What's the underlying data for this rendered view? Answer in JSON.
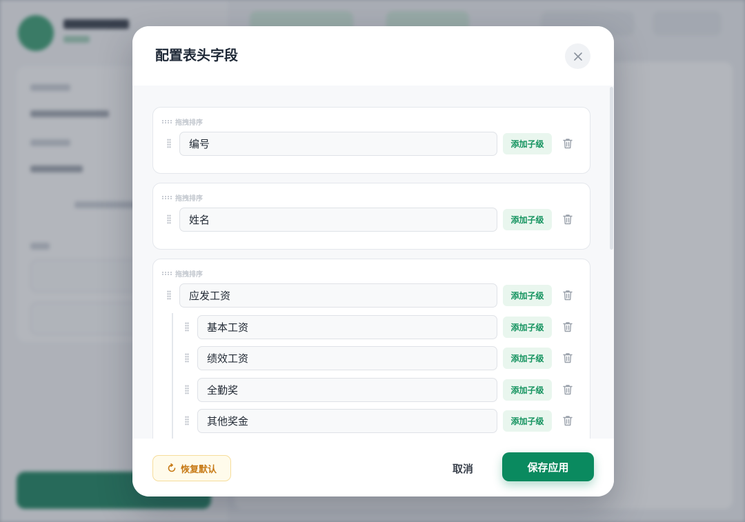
{
  "modal": {
    "title": "配置表头字段",
    "drag_hint": "拖拽排序",
    "add_child_label": "添加子级",
    "groups": [
      {
        "name": "编号",
        "children": []
      },
      {
        "name": "姓名",
        "children": []
      },
      {
        "name": "应发工资",
        "children": [
          "基本工资",
          "绩效工资",
          "全勤奖",
          "其他奖金"
        ]
      }
    ]
  },
  "footer": {
    "restore_label": "恢复默认",
    "cancel_label": "取消",
    "save_label": "保存应用"
  },
  "colors": {
    "primary": "#0a8a5f",
    "add_button_bg": "#e9f6ee",
    "restore_text": "#c77a16"
  },
  "icons": [
    "close-icon",
    "drag-handle-icon",
    "trash-icon",
    "restore-icon"
  ]
}
